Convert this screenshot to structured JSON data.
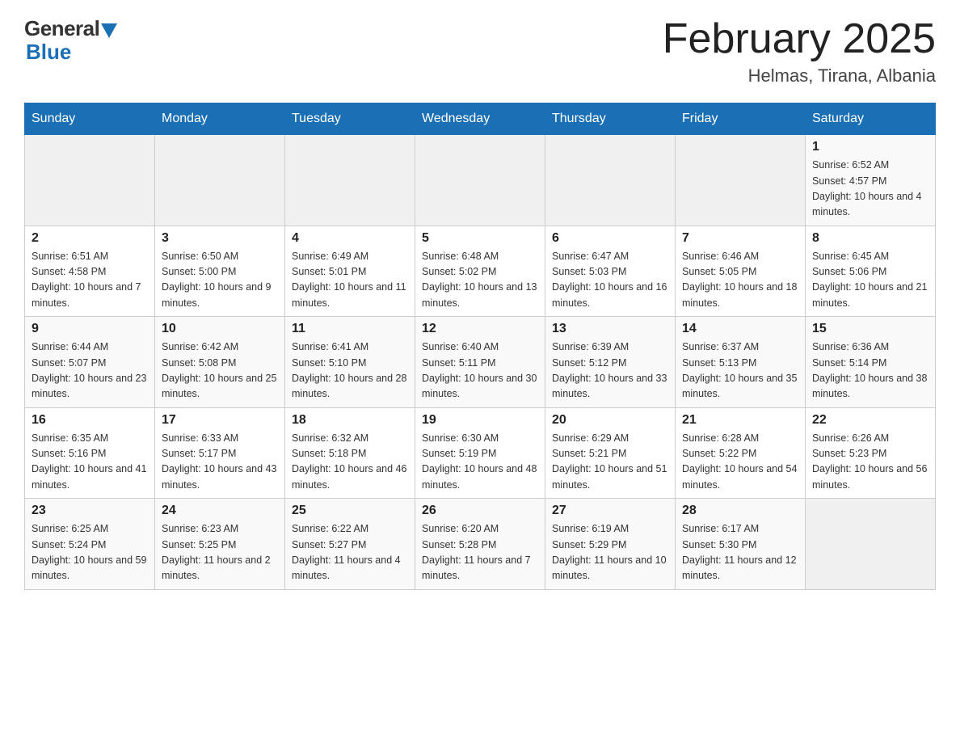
{
  "logo": {
    "general": "General",
    "blue": "Blue"
  },
  "title": "February 2025",
  "location": "Helmas, Tirana, Albania",
  "weekdays": [
    "Sunday",
    "Monday",
    "Tuesday",
    "Wednesday",
    "Thursday",
    "Friday",
    "Saturday"
  ],
  "weeks": [
    [
      {
        "day": "",
        "info": ""
      },
      {
        "day": "",
        "info": ""
      },
      {
        "day": "",
        "info": ""
      },
      {
        "day": "",
        "info": ""
      },
      {
        "day": "",
        "info": ""
      },
      {
        "day": "",
        "info": ""
      },
      {
        "day": "1",
        "info": "Sunrise: 6:52 AM\nSunset: 4:57 PM\nDaylight: 10 hours and 4 minutes."
      }
    ],
    [
      {
        "day": "2",
        "info": "Sunrise: 6:51 AM\nSunset: 4:58 PM\nDaylight: 10 hours and 7 minutes."
      },
      {
        "day": "3",
        "info": "Sunrise: 6:50 AM\nSunset: 5:00 PM\nDaylight: 10 hours and 9 minutes."
      },
      {
        "day": "4",
        "info": "Sunrise: 6:49 AM\nSunset: 5:01 PM\nDaylight: 10 hours and 11 minutes."
      },
      {
        "day": "5",
        "info": "Sunrise: 6:48 AM\nSunset: 5:02 PM\nDaylight: 10 hours and 13 minutes."
      },
      {
        "day": "6",
        "info": "Sunrise: 6:47 AM\nSunset: 5:03 PM\nDaylight: 10 hours and 16 minutes."
      },
      {
        "day": "7",
        "info": "Sunrise: 6:46 AM\nSunset: 5:05 PM\nDaylight: 10 hours and 18 minutes."
      },
      {
        "day": "8",
        "info": "Sunrise: 6:45 AM\nSunset: 5:06 PM\nDaylight: 10 hours and 21 minutes."
      }
    ],
    [
      {
        "day": "9",
        "info": "Sunrise: 6:44 AM\nSunset: 5:07 PM\nDaylight: 10 hours and 23 minutes."
      },
      {
        "day": "10",
        "info": "Sunrise: 6:42 AM\nSunset: 5:08 PM\nDaylight: 10 hours and 25 minutes."
      },
      {
        "day": "11",
        "info": "Sunrise: 6:41 AM\nSunset: 5:10 PM\nDaylight: 10 hours and 28 minutes."
      },
      {
        "day": "12",
        "info": "Sunrise: 6:40 AM\nSunset: 5:11 PM\nDaylight: 10 hours and 30 minutes."
      },
      {
        "day": "13",
        "info": "Sunrise: 6:39 AM\nSunset: 5:12 PM\nDaylight: 10 hours and 33 minutes."
      },
      {
        "day": "14",
        "info": "Sunrise: 6:37 AM\nSunset: 5:13 PM\nDaylight: 10 hours and 35 minutes."
      },
      {
        "day": "15",
        "info": "Sunrise: 6:36 AM\nSunset: 5:14 PM\nDaylight: 10 hours and 38 minutes."
      }
    ],
    [
      {
        "day": "16",
        "info": "Sunrise: 6:35 AM\nSunset: 5:16 PM\nDaylight: 10 hours and 41 minutes."
      },
      {
        "day": "17",
        "info": "Sunrise: 6:33 AM\nSunset: 5:17 PM\nDaylight: 10 hours and 43 minutes."
      },
      {
        "day": "18",
        "info": "Sunrise: 6:32 AM\nSunset: 5:18 PM\nDaylight: 10 hours and 46 minutes."
      },
      {
        "day": "19",
        "info": "Sunrise: 6:30 AM\nSunset: 5:19 PM\nDaylight: 10 hours and 48 minutes."
      },
      {
        "day": "20",
        "info": "Sunrise: 6:29 AM\nSunset: 5:21 PM\nDaylight: 10 hours and 51 minutes."
      },
      {
        "day": "21",
        "info": "Sunrise: 6:28 AM\nSunset: 5:22 PM\nDaylight: 10 hours and 54 minutes."
      },
      {
        "day": "22",
        "info": "Sunrise: 6:26 AM\nSunset: 5:23 PM\nDaylight: 10 hours and 56 minutes."
      }
    ],
    [
      {
        "day": "23",
        "info": "Sunrise: 6:25 AM\nSunset: 5:24 PM\nDaylight: 10 hours and 59 minutes."
      },
      {
        "day": "24",
        "info": "Sunrise: 6:23 AM\nSunset: 5:25 PM\nDaylight: 11 hours and 2 minutes."
      },
      {
        "day": "25",
        "info": "Sunrise: 6:22 AM\nSunset: 5:27 PM\nDaylight: 11 hours and 4 minutes."
      },
      {
        "day": "26",
        "info": "Sunrise: 6:20 AM\nSunset: 5:28 PM\nDaylight: 11 hours and 7 minutes."
      },
      {
        "day": "27",
        "info": "Sunrise: 6:19 AM\nSunset: 5:29 PM\nDaylight: 11 hours and 10 minutes."
      },
      {
        "day": "28",
        "info": "Sunrise: 6:17 AM\nSunset: 5:30 PM\nDaylight: 11 hours and 12 minutes."
      },
      {
        "day": "",
        "info": ""
      }
    ]
  ]
}
